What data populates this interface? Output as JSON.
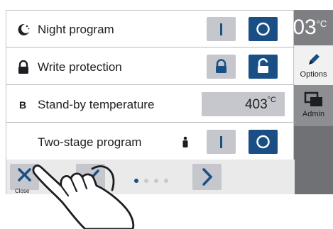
{
  "side": {
    "temperature_partial": ".03",
    "temperature_unit": "°C",
    "tabs": [
      {
        "label": "Options",
        "icon": "pen-icon"
      },
      {
        "label": "Admin",
        "icon": "windows-icon"
      }
    ]
  },
  "dialog": {
    "rows": [
      {
        "label": "Night program",
        "icon": "moon-icon",
        "buttons": [
          "on-button",
          "off-button"
        ],
        "selected": "off"
      },
      {
        "label": "Write protection",
        "icon": "lock-icon",
        "buttons": [
          "lock-button",
          "unlock-button"
        ],
        "selected": "unlock"
      },
      {
        "label": "Stand-by temperature",
        "icon_text": "B",
        "value": "403",
        "unit": "°C"
      },
      {
        "label": "Two-stage program",
        "indicator_icon": "person-icon",
        "buttons": [
          "on-button",
          "off-button"
        ],
        "selected": "off"
      }
    ],
    "footer": {
      "close_label": "Close",
      "page_dots": 4,
      "active_page": 1
    }
  },
  "colors": {
    "accent": "#1a4f86",
    "button_gray": "#c5c7cc",
    "side_dark": "#7d7f83"
  }
}
